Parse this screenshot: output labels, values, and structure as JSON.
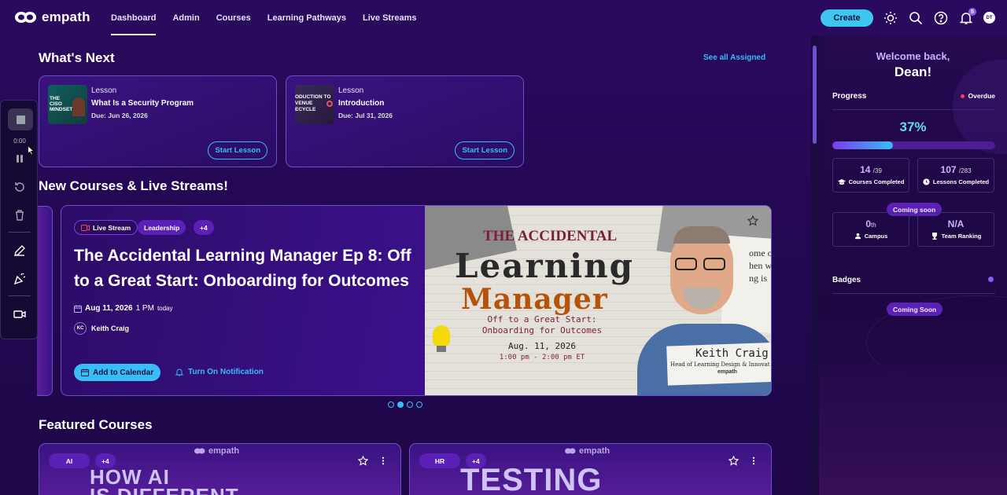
{
  "brand": {
    "name": "empath"
  },
  "nav": [
    {
      "label": "Dashboard",
      "active": true
    },
    {
      "label": "Admin"
    },
    {
      "label": "Courses"
    },
    {
      "label": "Learning Pathways"
    },
    {
      "label": "Live Streams"
    }
  ],
  "header": {
    "create_label": "Create",
    "notification_count": "5",
    "user_initials": "DT",
    "icons": [
      "sun-icon",
      "search-icon",
      "help-icon",
      "bell-icon"
    ]
  },
  "whats_next": {
    "title": "What's Next",
    "see_all": "See all Assigned",
    "cards": [
      {
        "type": "Lesson",
        "title": "What Is a Security Program",
        "due": "Due: Jun 26, 2026",
        "action": "Start Lesson",
        "thumb_text": "THE CISO MINDSET"
      },
      {
        "type": "Lesson",
        "title": "Introduction",
        "due": "Due: Jul 31, 2026",
        "action": "Start Lesson",
        "thumb_text": "ODUCTION TO VENUE ECYCLE"
      }
    ]
  },
  "recorder": {
    "time": "0:00"
  },
  "new_courses": {
    "title": "New Courses & Live Streams!",
    "featured_item": {
      "tags": [
        "Live Stream",
        "Leadership",
        "+4"
      ],
      "title": "The Accidental Learning Manager Ep 8: Off to a Great Start: Onboarding for Outcomes",
      "date": "Aug 11, 2026",
      "time": "1 PM",
      "relative": "today",
      "author_initials": "KC",
      "author": "Keith Craig",
      "add_calendar": "Add to Calendar",
      "notify": "Turn On Notification",
      "poster": {
        "line1": "THE ACCIDENTAL",
        "line2": "Learning",
        "line3": "Manager",
        "sub1": "Off to a Great Start:",
        "sub2": "Onboarding for Outcomes",
        "date": "Aug. 11, 2026",
        "time": "1:00 pm - 2:00 pm ET",
        "name": "Keith Craig",
        "role": "Head of Learning Design & Innovat",
        "brand": "empath",
        "scrap1": "ome o",
        "scrap2": "hen w",
        "scrap3": "ng is"
      }
    },
    "dots": 4,
    "active_dot": 1
  },
  "featured": {
    "title": "Featured Courses",
    "cards": [
      {
        "tags": [
          "AI",
          "+4"
        ],
        "brand": "empath",
        "big_text_1": "HOW AI",
        "big_text_2": "IS DIFFERENT"
      },
      {
        "tags": [
          "HR",
          "+4"
        ],
        "brand": "empath",
        "big_text_1": "TESTING"
      }
    ]
  },
  "sidebar": {
    "welcome": "Welcome back,",
    "name": "Dean!",
    "progress_title": "Progress",
    "overdue": "Overdue",
    "percent_text": "37%",
    "percent_value": 0.37,
    "courses_done": "14",
    "courses_total": "/39",
    "courses_label": "Courses Completed",
    "lessons_done": "107",
    "lessons_total": "/283",
    "lessons_label": "Lessons Completed",
    "coming_soon_1": "Coming soon",
    "campus_rank": "0",
    "campus_suffix": "th",
    "campus_label": "Campus",
    "team_rank": "N/A",
    "team_label": "Team Ranking",
    "badges_title": "Badges",
    "coming_soon_2": "Coming Soon"
  }
}
